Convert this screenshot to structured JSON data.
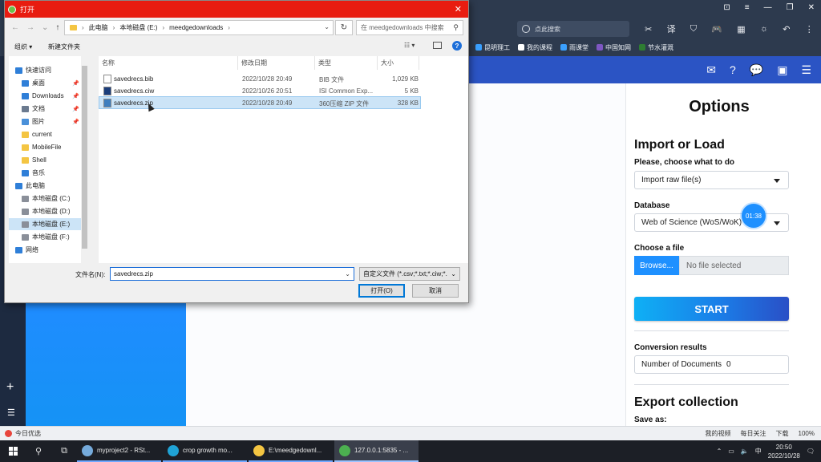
{
  "browser": {
    "search_placeholder": "点此搜索",
    "bookmarks": [
      {
        "label": "昆明理工",
        "color": "#3aa0ff"
      },
      {
        "label": "我的课程",
        "color": "#ffffff"
      },
      {
        "label": "雨课堂",
        "color": "#3aa0ff"
      },
      {
        "label": "中国知网",
        "color": "#7e57c2"
      },
      {
        "label": "节水灌溉",
        "color": "#2e7d32"
      }
    ],
    "status_left": "今日优选",
    "status_right": {
      "video": "我的视频",
      "follow": "每日关注",
      "download": "下载",
      "zoom": "100%"
    }
  },
  "app": {
    "nav_icons": [
      "mail-open-icon",
      "help-icon",
      "chat-icon",
      "box-icon",
      "hamburger-icon"
    ],
    "options": {
      "title": "Options",
      "import_heading": "Import or Load",
      "choose_label": "Please, choose what to do",
      "choose_value": "Import raw file(s)",
      "database_label": "Database",
      "database_value": "Web of Science (WoS/WoK)",
      "file_label": "Choose a file",
      "browse_label": "Browse...",
      "no_file": "No file selected",
      "start_label": "START",
      "conversion_label": "Conversion results",
      "num_docs_label": "Number of Documents",
      "num_docs_value": "0",
      "export_heading": "Export collection",
      "save_as_label": "Save as:"
    },
    "timer": "01:38"
  },
  "dialog": {
    "title": "打开",
    "breadcrumb": [
      "此电脑",
      "本地磁盘 (E:)",
      "meedgedownloads"
    ],
    "search_placeholder": "在 meedgedownloads 中搜索",
    "organize": "组织 ▾",
    "new_folder": "新建文件夹",
    "nav_items": [
      {
        "label": "快速访问",
        "icon": "star-icon",
        "color": "#2f7fd8",
        "level": 0,
        "pin": false
      },
      {
        "label": "桌面",
        "icon": "desktop-icon",
        "color": "#2f7fd8",
        "level": 1,
        "pin": true
      },
      {
        "label": "Downloads",
        "icon": "download-icon",
        "color": "#2f7fd8",
        "level": 1,
        "pin": true
      },
      {
        "label": "文档",
        "icon": "document-icon",
        "color": "#6b7a8f",
        "level": 1,
        "pin": true
      },
      {
        "label": "图片",
        "icon": "picture-icon",
        "color": "#4a90d9",
        "level": 1,
        "pin": true
      },
      {
        "label": "current",
        "icon": "folder-icon",
        "color": "#f4c542",
        "level": 1,
        "pin": false
      },
      {
        "label": "MobileFile",
        "icon": "folder-icon",
        "color": "#f4c542",
        "level": 1,
        "pin": false
      },
      {
        "label": "Shell",
        "icon": "folder-icon",
        "color": "#f4c542",
        "level": 1,
        "pin": false
      },
      {
        "label": "音乐",
        "icon": "music-icon",
        "color": "#2f7fd8",
        "level": 1,
        "pin": false
      },
      {
        "label": "此电脑",
        "icon": "computer-icon",
        "color": "#2f7fd8",
        "level": 0,
        "pin": false
      },
      {
        "label": "本地磁盘 (C:)",
        "icon": "drive-icon",
        "color": "#8a8f99",
        "level": 1,
        "pin": false
      },
      {
        "label": "本地磁盘 (D:)",
        "icon": "drive-icon",
        "color": "#8a8f99",
        "level": 1,
        "pin": false
      },
      {
        "label": "本地磁盘 (E:)",
        "icon": "drive-icon",
        "color": "#8a8f99",
        "level": 1,
        "pin": false,
        "selected": true
      },
      {
        "label": "本地磁盘 (F:)",
        "icon": "drive-icon",
        "color": "#8a8f99",
        "level": 1,
        "pin": false
      },
      {
        "label": "网络",
        "icon": "network-icon",
        "color": "#2f7fd8",
        "level": 0,
        "pin": false
      }
    ],
    "columns": [
      "名称",
      "修改日期",
      "类型",
      "大小"
    ],
    "files": [
      {
        "name": "savedrecs.bib",
        "date": "2022/10/28 20:49",
        "type": "BIB 文件",
        "size": "1,029 KB",
        "icon": "text-file-icon",
        "selected": false
      },
      {
        "name": "savedrecs.ciw",
        "date": "2022/10/26 20:51",
        "type": "ISI Common Exp...",
        "size": "5 KB",
        "icon": "isi-file-icon",
        "selected": false
      },
      {
        "name": "savedrecs.zip",
        "date": "2022/10/28 20:49",
        "type": "360压缩 ZIP 文件",
        "size": "328 KB",
        "icon": "zip-file-icon",
        "selected": true
      }
    ],
    "filename_label": "文件名(N):",
    "filename_value": "savedrecs.zip",
    "filetype_value": "自定义文件 (*.csv;*.txt;*.ciw;*.",
    "open_label": "打开(O)",
    "cancel_label": "取消"
  },
  "taskbar": {
    "apps": [
      {
        "label": "myproject2 - RSt...",
        "icon": "rstudio-icon",
        "color": "#75aadb"
      },
      {
        "label": "crop growth mo...",
        "icon": "edge-icon",
        "color": "#1fa3d6"
      },
      {
        "label": "E:\\meedgedownl...",
        "icon": "folder-icon",
        "color": "#f4c542"
      },
      {
        "label": "127.0.0.1:5835 - ...",
        "icon": "browser-360-icon",
        "color": "#4cb050",
        "active": true
      }
    ],
    "ime": "中",
    "time": "20:50",
    "date": "2022/10/28"
  }
}
